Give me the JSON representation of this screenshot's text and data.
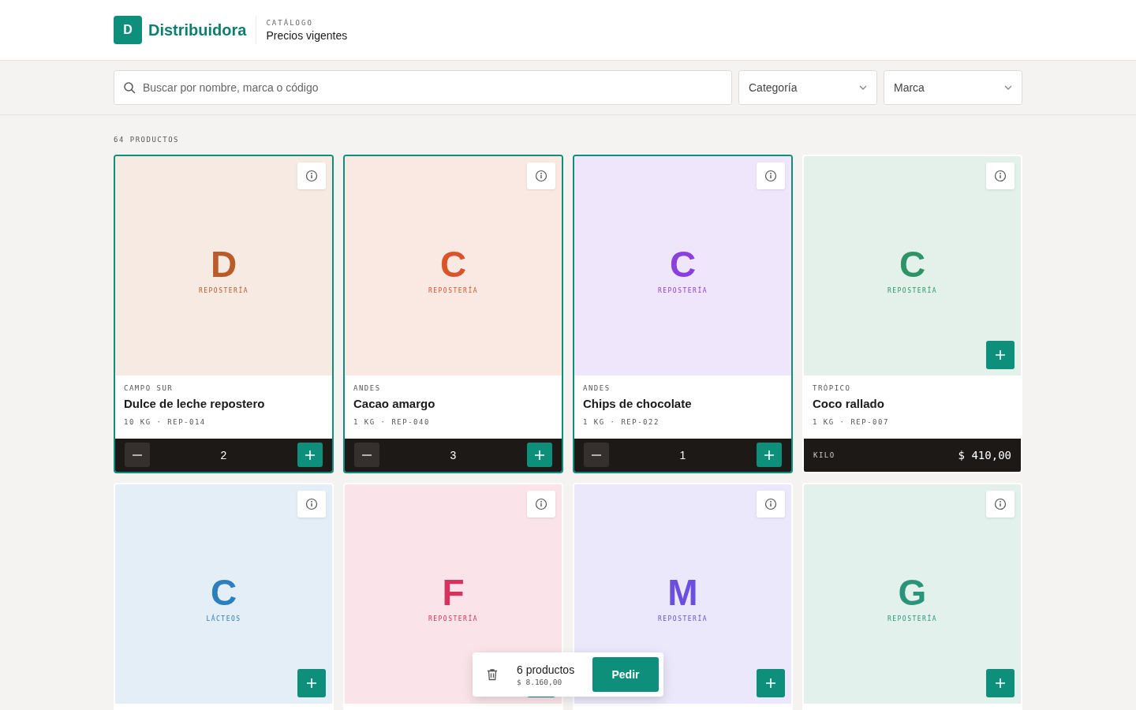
{
  "brand": {
    "logo": "D",
    "name": "Distribuidora"
  },
  "page": {
    "eyebrow": "CATÁLOGO",
    "title": "Precios vigentes"
  },
  "filters": {
    "search": {
      "placeholder": "Buscar por nombre, marca o código"
    },
    "dropdowns": [
      {
        "label": "Categoría"
      },
      {
        "label": "Marca"
      }
    ]
  },
  "count": "64 PRODUCTOS",
  "products": [
    {
      "kind": "in_cart",
      "monogram": "D",
      "category": "REPOSTERÍA",
      "color": "#b85c2a",
      "brand": "CAMPO SUR",
      "name": "Dulce de leche repostero",
      "meta": "10 KG · REP-014",
      "quantity": "2"
    },
    {
      "kind": "in_cart",
      "monogram": "C",
      "category": "REPOSTERÍA",
      "color": "#d9542a",
      "brand": "ANDES",
      "name": "Cacao amargo",
      "meta": "1 KG · REP-040",
      "quantity": "3"
    },
    {
      "kind": "in_cart",
      "monogram": "C",
      "category": "REPOSTERÍA",
      "color": "#8a3fe0",
      "brand": "ANDES",
      "name": "Chips de chocolate",
      "meta": "1 KG · REP-022",
      "quantity": "1"
    },
    {
      "kind": "available",
      "monogram": "C",
      "category": "REPOSTERÍA",
      "color": "#2e9466",
      "brand": "TRÓPICO",
      "name": "Coco rallado",
      "meta": "1 KG · REP-007",
      "unit": "KILO",
      "price": "$ 410,00"
    },
    {
      "kind": "available",
      "monogram": "C",
      "category": "LÁCTEOS",
      "color": "#2b7fbf"
    },
    {
      "kind": "available",
      "monogram": "F",
      "category": "REPOSTERÍA",
      "color": "#d6335e"
    },
    {
      "kind": "available",
      "monogram": "M",
      "category": "REPOSTERÍA",
      "color": "#6a4fe0"
    },
    {
      "kind": "available",
      "monogram": "G",
      "category": "REPOSTERÍA",
      "color": "#2b9478"
    }
  ],
  "cart": {
    "count": "6 productos",
    "total": "$ 8.160,00",
    "action": "Pedir"
  }
}
